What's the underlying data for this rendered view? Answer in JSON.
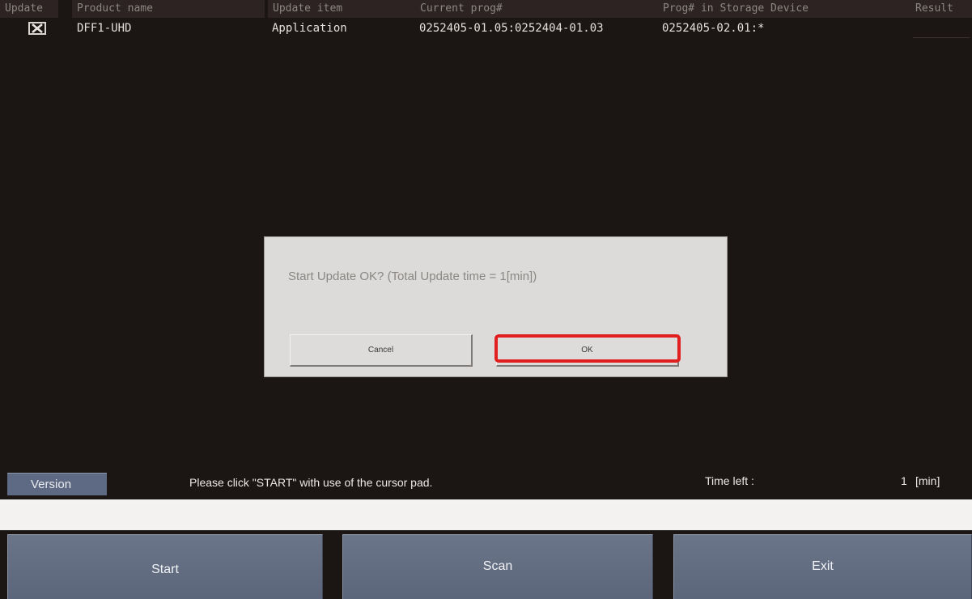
{
  "table": {
    "headers": [
      "Update",
      "Product name",
      "Update item",
      "Current prog#",
      "Prog# in Storage Device",
      "Result"
    ],
    "row": {
      "checkbox_icon": "x-mark-icon",
      "checked": true,
      "product_name": "DFF1-UHD",
      "update_item": "Application",
      "current_prog": "0252405-01.05:0252404-01.03",
      "storage_prog": "0252405-02.01:*"
    }
  },
  "dialog": {
    "message": "Start Update OK?  (Total Update time = 1[min])",
    "cancel_label": "Cancel",
    "ok_label": "OK",
    "highlight_color": "#e21f1f"
  },
  "status": {
    "version_label": "Version",
    "message": "Please click \"START\" with use of the cursor pad.",
    "time_left_label": "Time left :",
    "time_left_value": "1",
    "time_left_unit": "[min]",
    "progress": 0
  },
  "footer": {
    "start_label": "Start",
    "scan_label": "Scan",
    "exit_label": "Exit"
  },
  "colors": {
    "background": "#1b1513",
    "button_blue": "#5e6a83"
  }
}
